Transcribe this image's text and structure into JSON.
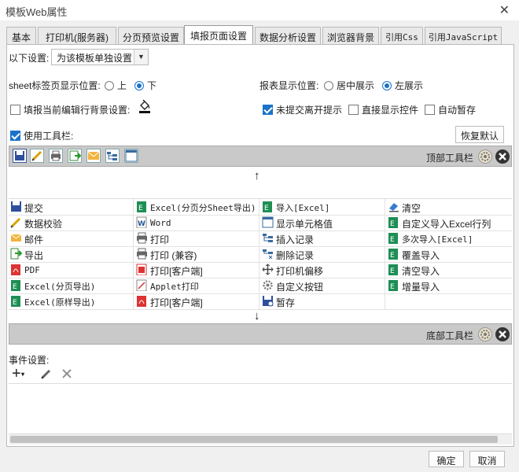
{
  "window": {
    "title": "模板Web属性",
    "close_glyph": "✕"
  },
  "tabs": [
    {
      "label": "基本",
      "active": false
    },
    {
      "label": "打印机(服务器)",
      "active": false
    },
    {
      "label": "分页预览设置",
      "active": false
    },
    {
      "label": "填报页面设置",
      "active": true
    },
    {
      "label": "数据分析设置",
      "active": false
    },
    {
      "label": "浏览器背景",
      "active": false
    },
    {
      "label": "引用Css",
      "active": false
    },
    {
      "label": "引用JavaScript",
      "active": false
    }
  ],
  "settings": {
    "scope_label": "以下设置:",
    "scope_value": "为该模板单独设置",
    "sheet_tab_label": "sheet标签页显示位置:",
    "sheet_tab_options": [
      {
        "label": "上",
        "selected": false
      },
      {
        "label": "下",
        "selected": true
      }
    ],
    "report_pos_label": "报表显示位置:",
    "report_pos_options": [
      {
        "label": "居中展示",
        "selected": false
      },
      {
        "label": "左展示",
        "selected": true
      }
    ],
    "fill_bg_label": "填报当前编辑行背景设置:",
    "fill_bg_checked": false,
    "unsubmitted_label": "未提交离开提示",
    "unsubmitted_checked": true,
    "direct_ctrl_label": "直接显示控件",
    "direct_ctrl_checked": false,
    "autosave_label": "自动暂存",
    "autosave_checked": false,
    "use_toolbar_label": "使用工具栏:",
    "use_toolbar_checked": true,
    "restore_default": "恢复默认"
  },
  "top_toolbar": {
    "label": "顶部工具栏"
  },
  "bottom_toolbar": {
    "label": "底部工具栏"
  },
  "arrows": {
    "up": "↑",
    "down": "↓"
  },
  "toolbar_items": [
    [
      "提交",
      "Excel(分页分Sheet导出)",
      "导入[Excel]",
      "清空"
    ],
    [
      "数据校验",
      "Word",
      "显示单元格值",
      "自定义导入Excel行列"
    ],
    [
      "邮件",
      "打印",
      "插入记录",
      "多次导入[Excel]"
    ],
    [
      "导出",
      "打印 (兼容)",
      "删除记录",
      "覆盖导入"
    ],
    [
      "PDF",
      "打印[客户端]",
      "打印机偏移",
      "清空导入"
    ],
    [
      "Excel(分页导出)",
      "Applet打印",
      "自定义按钮",
      "增量导入"
    ],
    [
      "Excel(原样导出)",
      "打印[客户端]",
      "暂存",
      ""
    ]
  ],
  "events": {
    "label": "事件设置:"
  },
  "footer": {
    "ok": "确定",
    "cancel": "取消"
  },
  "colors": {
    "accent": "#1a73c9",
    "toolbar_strip": "#c9c9c9",
    "excel_green": "#1e8f54",
    "pdf_red": "#d33"
  }
}
